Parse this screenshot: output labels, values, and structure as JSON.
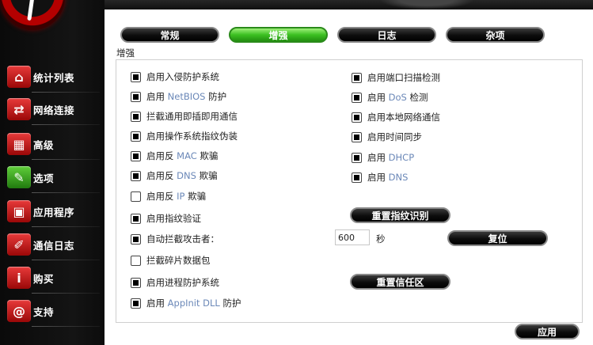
{
  "sidebar": {
    "items": [
      {
        "label": "统计列表",
        "icon": "home-icon",
        "icon_glyph": "⌂"
      },
      {
        "label": "网络连接",
        "icon": "arrows-exchange-icon",
        "icon_glyph": "⇄"
      },
      {
        "label": "高级",
        "icon": "gift-box-icon",
        "icon_glyph": "▦"
      },
      {
        "label": "选项",
        "icon": "wrench-icon",
        "icon_glyph": "✎"
      },
      {
        "label": "应用程序",
        "icon": "app-window-gear-icon",
        "icon_glyph": "▣"
      },
      {
        "label": "通信日志",
        "icon": "pen-log-icon",
        "icon_glyph": "✐"
      },
      {
        "label": "购买",
        "icon": "info-icon",
        "icon_glyph": "i"
      },
      {
        "label": "支持",
        "icon": "at-sign-icon",
        "icon_glyph": "@"
      }
    ]
  },
  "tabs": [
    {
      "label": "常规",
      "active": false
    },
    {
      "label": "增强",
      "active": true
    },
    {
      "label": "日志",
      "active": false
    },
    {
      "label": "杂项",
      "active": false
    }
  ],
  "section_label": "增强",
  "left_options": [
    {
      "text": "启用入侵防护系统",
      "checked": true
    },
    {
      "pre": "启用 ",
      "hl": "NetBIOS",
      "post": " 防护",
      "checked": true
    },
    {
      "text": "拦截通用即插即用通信",
      "checked": true
    },
    {
      "text": "启用操作系统指纹伪装",
      "checked": true
    },
    {
      "pre": "启用反 ",
      "hl": "MAC",
      "post": " 欺骗",
      "checked": true
    },
    {
      "pre": "启用反 ",
      "hl": "DNS",
      "post": " 欺骗",
      "checked": true
    },
    {
      "pre": "启用反 ",
      "hl": "IP",
      "post": " 欺骗",
      "checked": false
    },
    {
      "text": "启用指纹验证",
      "checked": true
    },
    {
      "text": "自动拦截攻击者：",
      "checked": true
    },
    {
      "text": "拦截碎片数据包",
      "checked": false
    },
    {
      "text": "启用进程防护系统",
      "checked": true
    },
    {
      "pre": "启用 ",
      "hl": "AppInit DLL",
      "post": " 防护",
      "checked": true
    }
  ],
  "right_options": [
    {
      "text": "启用端口扫描检测",
      "checked": true
    },
    {
      "pre": "启用 ",
      "hl": "DoS",
      "post": " 检测",
      "checked": true
    },
    {
      "text": "启用本地网络通信",
      "checked": true
    },
    {
      "text": "启用时间同步",
      "checked": true
    },
    {
      "pre": "启用 ",
      "hl": "DHCP",
      "post": "",
      "checked": true
    },
    {
      "pre": "启用 ",
      "hl": "DNS",
      "post": "",
      "checked": true
    }
  ],
  "buttons": {
    "reset_fingerprint": "重置指纹识别",
    "reset_timer": "复位",
    "reset_trusted_zone": "重置信任区",
    "apply": "应用"
  },
  "block_time": {
    "value": "600",
    "unit": "秒"
  }
}
